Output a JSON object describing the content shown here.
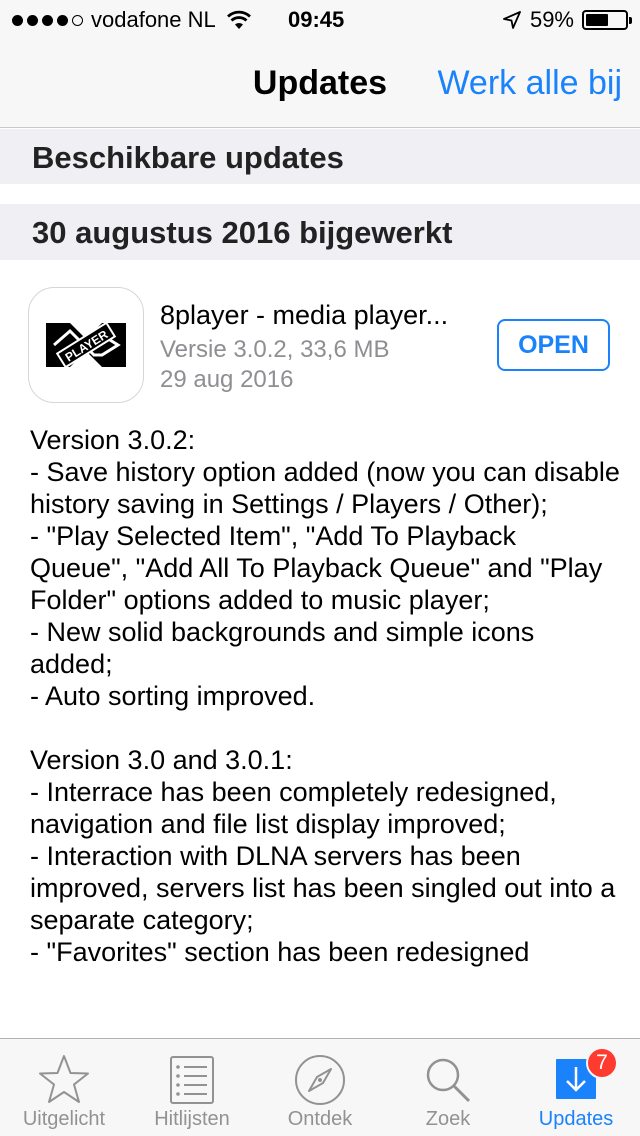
{
  "status_bar": {
    "carrier": "vodafone NL",
    "time": "09:45",
    "battery_percent": "59%",
    "battery_level": 0.59,
    "signal_bars_filled": 4,
    "signal_bars_total": 5,
    "icons": [
      "wifi-icon",
      "location-arrow-icon",
      "battery-icon"
    ]
  },
  "nav": {
    "title": "Updates",
    "action": "Werk alle bij"
  },
  "sections": {
    "available": "Beschikbare updates",
    "updated": "30 augustus 2016 bijgewerkt"
  },
  "app": {
    "name": "8player - media player...",
    "version_size": "Versie 3.0.2, 33,6 MB",
    "date": "29 aug 2016",
    "icon_text": "PLAYER",
    "open_label": "OPEN",
    "release_notes": "Version 3.0.2:\n- Save history option added (now you can disable history saving in Settings / Players / Other);\n- \"Play Selected Item\", \"Add To Playback Queue\", \"Add All To Playback Queue\" and \"Play Folder\" options added to music player;\n- New solid backgrounds and simple icons added;\n- Auto sorting improved.\n\nVersion 3.0 and 3.0.1:\n- Interrace has been completely redesigned, navigation and file list display improved;\n- Interaction with DLNA servers has been improved, servers list has been singled out into a separate category;\n- \"Favorites\" section has been redesigned"
  },
  "tabs": [
    {
      "label": "Uitgelicht",
      "icon": "star-icon"
    },
    {
      "label": "Hitlijsten",
      "icon": "list-icon"
    },
    {
      "label": "Ontdek",
      "icon": "compass-icon"
    },
    {
      "label": "Zoek",
      "icon": "search-icon"
    },
    {
      "label": "Updates",
      "icon": "download-icon",
      "badge": "7",
      "active": true
    }
  ],
  "colors": {
    "accent": "#1a82fb",
    "badge": "#ff3b30",
    "inactive": "#929292",
    "section_bg": "#efeff4"
  }
}
